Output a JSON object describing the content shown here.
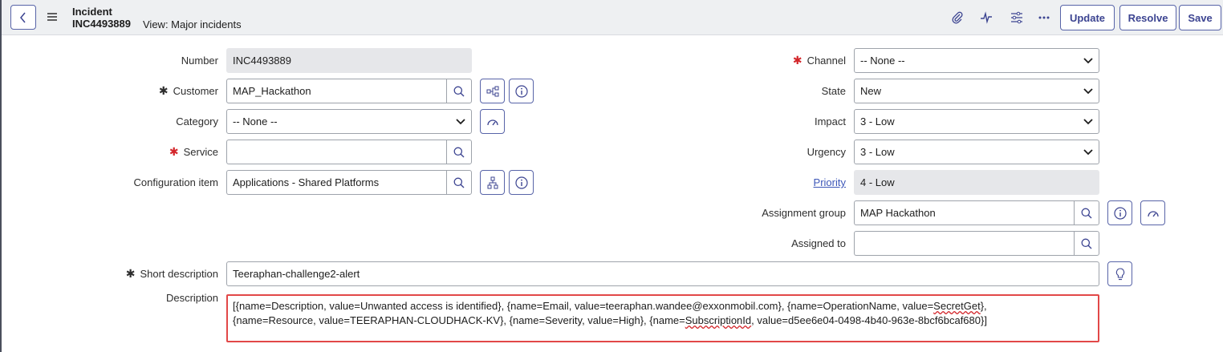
{
  "header": {
    "record_type": "Incident",
    "record_number": "INC4493889",
    "view_label": "View: Major incidents",
    "buttons": {
      "update": "Update",
      "resolve": "Resolve",
      "save": "Save"
    },
    "icons": [
      "back-icon",
      "menu-icon",
      "attachment-icon",
      "activity-icon",
      "settings-sliders-icon",
      "more-icon"
    ]
  },
  "form": {
    "number": {
      "label": "Number",
      "value": "INC4493889"
    },
    "customer": {
      "label": "Customer",
      "value": "MAP_Hackathon",
      "required": true
    },
    "category": {
      "label": "Category",
      "value": "-- None --"
    },
    "service": {
      "label": "Service",
      "value": "",
      "required": true
    },
    "configuration_item": {
      "label": "Configuration item",
      "value": "Applications - Shared Platforms"
    },
    "channel": {
      "label": "Channel",
      "value": "-- None --",
      "required": true
    },
    "state": {
      "label": "State",
      "value": "New"
    },
    "impact": {
      "label": "Impact",
      "value": "3 - Low"
    },
    "urgency": {
      "label": "Urgency",
      "value": "3 - Low"
    },
    "priority": {
      "label": "Priority",
      "value": "4 - Low"
    },
    "assignment_group": {
      "label": "Assignment group",
      "value": "MAP Hackathon"
    },
    "assigned_to": {
      "label": "Assigned to",
      "value": ""
    },
    "short_description": {
      "label": "Short description",
      "value": "Teeraphan-challenge2-alert",
      "required": true
    },
    "description": {
      "label": "Description",
      "line1_a": "[{name=Description, value=Unwanted access is identified}, {name=Email, value=teeraphan.wandee@exxonmobil.com}, {name=OperationName, value=",
      "line1_b": "SecretGet",
      "line1_c": "},",
      "line2_a": "{name=Resource, value=TEERAPHAN-CLOUDHACK-KV}, {name=Severity, value=High}, {name=",
      "line2_b": "SubscriptionId",
      "line2_c": ", value=d5ee6e04-0498-4b40-963e-8bcf6bcaf680}]"
    }
  },
  "colors": {
    "accent": "#3c4491",
    "required_red": "#d3262b",
    "highlight_border": "#e24848",
    "header_bg": "#eef0f2",
    "readonly_bg": "#e6e7ea"
  }
}
